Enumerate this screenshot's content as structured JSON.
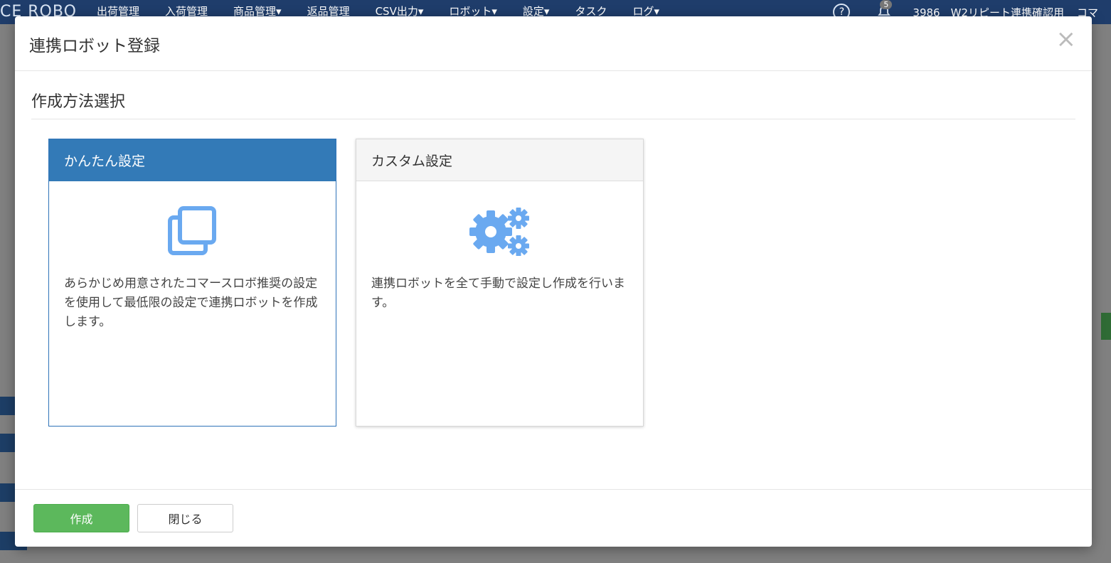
{
  "background": {
    "logo": "CE ROBO",
    "nav_items": [
      "出荷管理",
      "入荷管理",
      "商品管理▾",
      "返品管理",
      "CSV出力▾",
      "ロボット▾",
      "設定▾",
      "タスク",
      "ログ▾"
    ],
    "notification_count": "5",
    "account": "3986　W2リピート連携確認用",
    "account_suffix": "コマ"
  },
  "modal": {
    "title": "連携ロボット登録",
    "close_label": "×",
    "section_title": "作成方法選択",
    "cards": [
      {
        "title": "かんたん設定",
        "icon": "copy-icon",
        "description": "あらかじめ用意されたコマースロボ推奨の設定を使用して最低限の設定で連携ロボットを作成します。",
        "selected": true
      },
      {
        "title": "カスタム設定",
        "icon": "gears-icon",
        "description": "連携ロボットを全て手動で設定し作成を行います。",
        "selected": false
      }
    ],
    "buttons": {
      "create": "作成",
      "close": "閉じる"
    }
  },
  "colors": {
    "primary": "#337ab7",
    "success": "#5cb85c",
    "icon": "#6aa9f0"
  }
}
